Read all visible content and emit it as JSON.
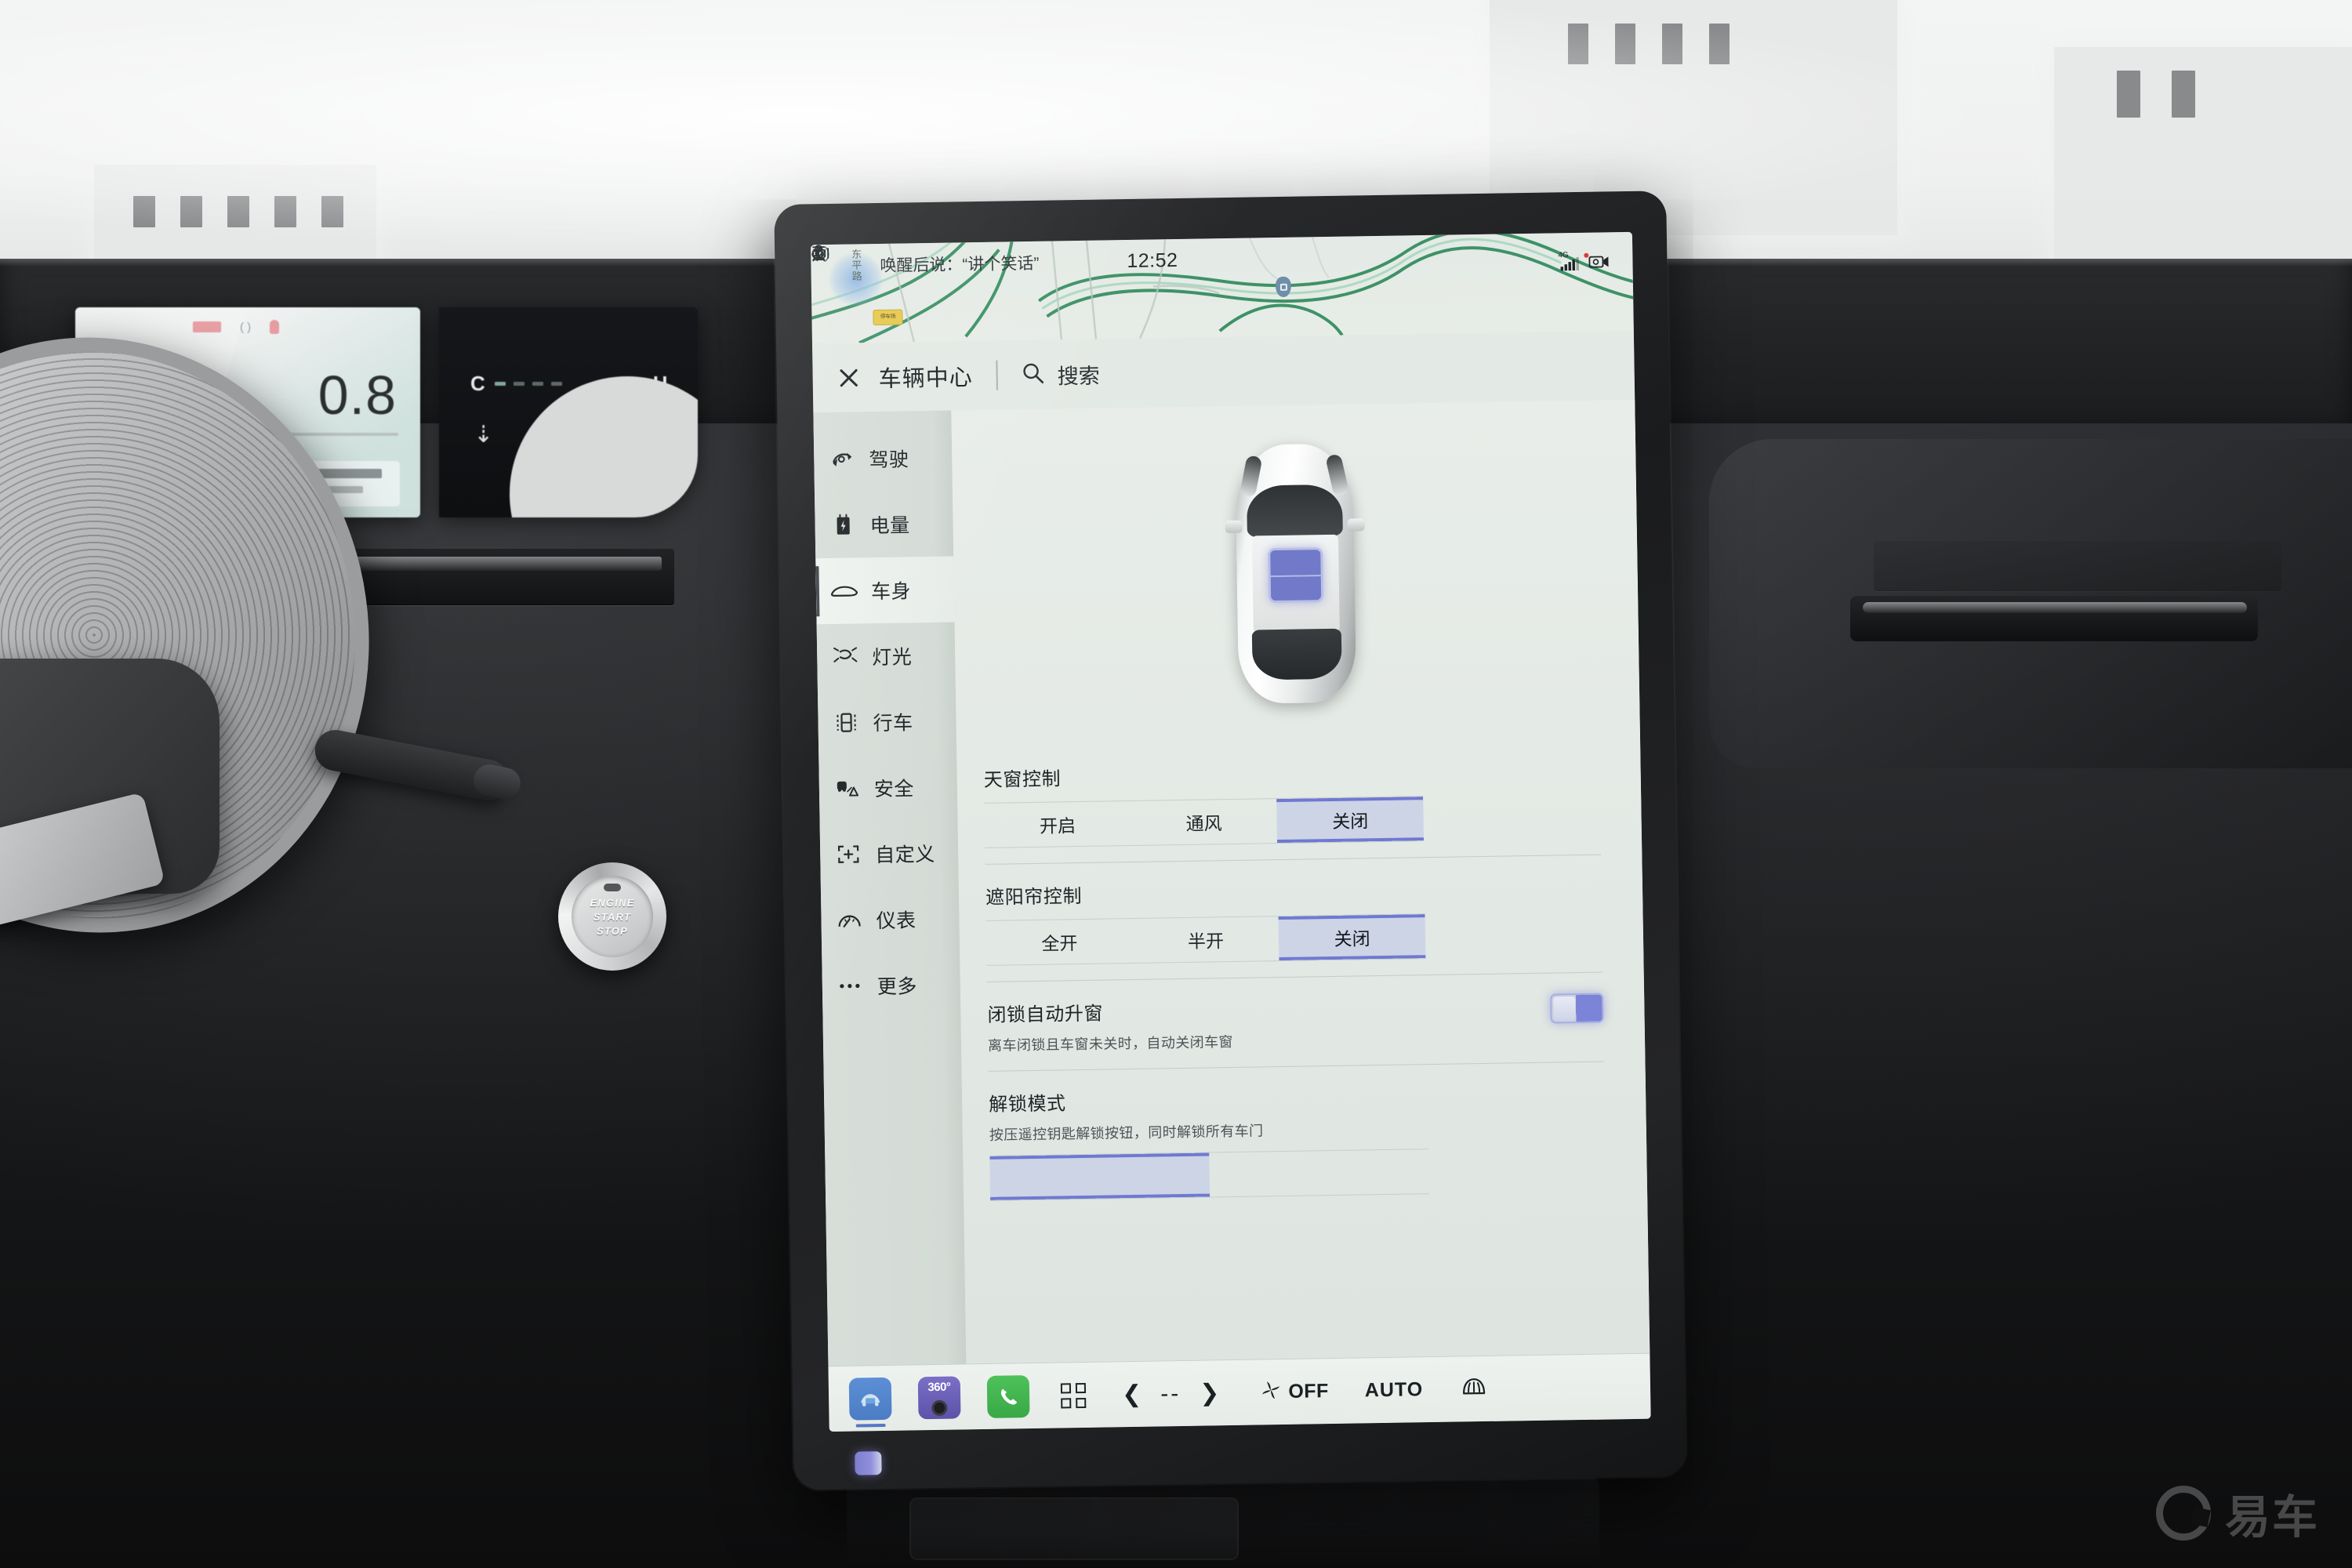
{
  "scene": {
    "description": "car-interior-dashboard-with-center-touchscreen"
  },
  "cluster": {
    "speed": "0.8",
    "gauge_cold": "C",
    "gauge_hot": "H",
    "down_arrow_icon": "arrow-down-icon"
  },
  "start_button": {
    "line1": "ENGINE",
    "line2": "START",
    "line3": "STOP"
  },
  "screen": {
    "status_bar": {
      "voice_hint": "唤醒后说：“讲个笑话”",
      "clock": "12:52",
      "icons": [
        "user-profile-icon",
        "volume-icon",
        "signal-4g-icon",
        "bluetooth-icon",
        "dashcam-icon",
        "hotspot-icon",
        "download-icon"
      ],
      "network_label": "4G"
    },
    "map": {
      "road_label": "东平路",
      "poi_label": "停车场"
    },
    "header": {
      "close_label": "close-icon",
      "title": "车辆中心",
      "search_label": "搜索",
      "search_icon": "search-icon"
    },
    "sidebar": {
      "items": [
        {
          "label": "驾驶",
          "icon": "steering-wheel-icon",
          "active": false
        },
        {
          "label": "电量",
          "icon": "battery-charge-icon",
          "active": false
        },
        {
          "label": "车身",
          "icon": "car-body-icon",
          "active": true
        },
        {
          "label": "灯光",
          "icon": "headlight-icon",
          "active": false
        },
        {
          "label": "行车",
          "icon": "driving-icon",
          "active": false
        },
        {
          "label": "安全",
          "icon": "safety-icon",
          "active": false
        },
        {
          "label": "自定义",
          "icon": "customize-icon",
          "active": false
        },
        {
          "label": "仪表",
          "icon": "gauge-icon",
          "active": false
        },
        {
          "label": "更多",
          "icon": "more-dots-icon",
          "active": false
        }
      ]
    },
    "content": {
      "car_illustration": "top-down-car-sunroof-highlighted",
      "sections": [
        {
          "title": "天窗控制",
          "type": "segmented",
          "options": [
            "开启",
            "通风",
            "关闭"
          ],
          "selected": "关闭"
        },
        {
          "title": "遮阳帘控制",
          "type": "segmented",
          "options": [
            "全开",
            "半开",
            "关闭"
          ],
          "selected": "关闭"
        },
        {
          "title": "闭锁自动升窗",
          "type": "toggle",
          "subtitle": "离车闭锁且车窗未关时，自动关闭车窗",
          "value": "on"
        },
        {
          "title": "解锁模式",
          "type": "segmented",
          "subtitle": "按压遥控钥匙解锁按钮，同时解锁所有车门",
          "options": [
            "",
            ""
          ],
          "selected": ""
        }
      ]
    },
    "dock": {
      "items": [
        {
          "label": "",
          "icon": "vehicle-app-icon",
          "active": true
        },
        {
          "label": "360°",
          "icon": "camera-360-icon",
          "active": false
        },
        {
          "label": "",
          "icon": "phone-app-icon",
          "active": false
        },
        {
          "label": "",
          "icon": "app-grid-icon",
          "active": false
        }
      ],
      "temp_value": "--",
      "temp_down_icon": "chevron-left-icon",
      "temp_up_icon": "chevron-right-icon",
      "fan_label": "OFF",
      "fan_icon": "fan-icon",
      "auto_label": "AUTO",
      "defrost_icon": "rear-defrost-icon"
    }
  },
  "watermark": {
    "text": "易车",
    "logo": "yiche-circle-logo"
  }
}
